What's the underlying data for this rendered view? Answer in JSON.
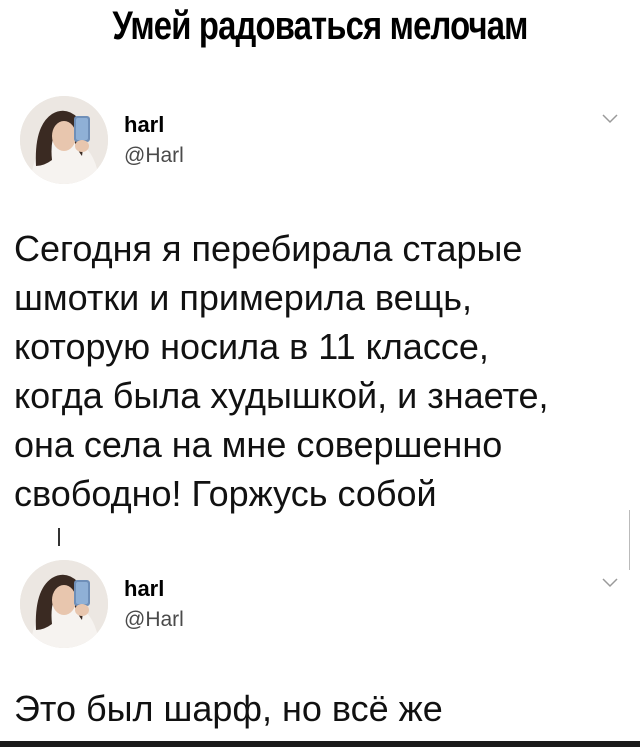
{
  "headline": "Умей радоваться мелочам",
  "tweets": [
    {
      "name": "harl",
      "handle": "@Harl",
      "text": "Сегодня я перебирала старые\nшмотки и примерила вещь,\nкоторую носила в 11 классе,\nкогда была худышкой, и знаете,\nона села на мне совершенно\nсвободно! Горжусь собой"
    },
    {
      "name": "harl",
      "handle": "@Harl",
      "text": "Это был шарф, но всё же"
    }
  ],
  "icons": {
    "menu": "chevron-down-icon",
    "avatar": "avatar-photo"
  },
  "colors": {
    "background": "#ffffff",
    "text": "#000000",
    "handle": "#4a4a4a"
  }
}
